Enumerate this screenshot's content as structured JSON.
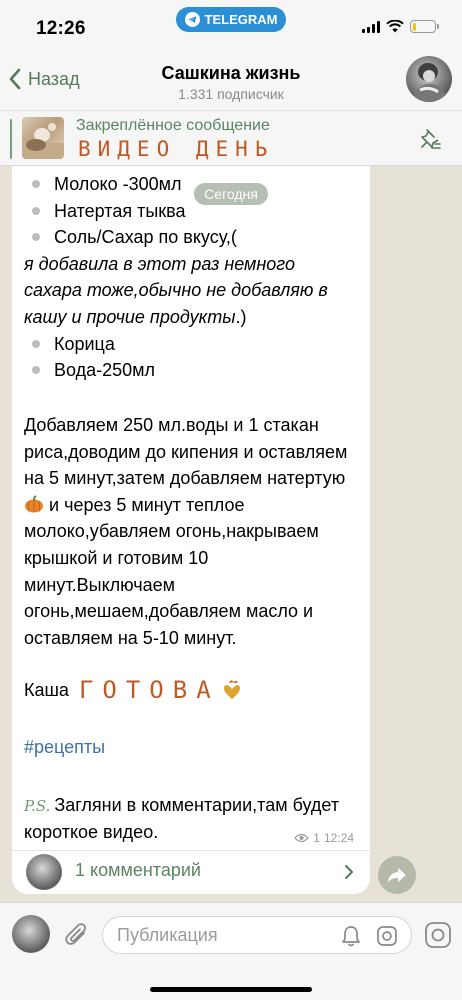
{
  "status": {
    "time": "12:26",
    "app_pill": "TELEGRAM",
    "battery_level": 0.18
  },
  "header": {
    "back_label": "Назад",
    "title": "Сашкина жизнь",
    "subtitle": "1.331 подписчик"
  },
  "pinned": {
    "label": "Закреплённое сообщение",
    "text": "ВИДЕО ДЕНЬ"
  },
  "date_chip": "Сегодня",
  "message": {
    "list_top": [
      "Молоко -300мл",
      "Натертая тыква"
    ],
    "salt_item": "Соль/Сахар по вкусу,(",
    "salt_italic": "я добавила в этот раз немного сахара тоже,обычно не добавляю в кашу и прочие продукты",
    "salt_tail": ".)",
    "list_bottom": [
      "Корица",
      "Вода-250мл"
    ],
    "para_part1": "Добавляем 250 мл.воды и 1 стакан риса,доводим до кипения и оставляем на 5 минут,затем добавляем натертую",
    "para_part2": "и через 5 минут теплое молоко,убавляем огонь,накрываем крышкой и готовим 10 минут.Выключаем огонь,мешаем,добавляем масло и оставляем на 5-10 минут.",
    "kasha_label": "Каша",
    "kasha_word": "ГОТОВА",
    "hashtag": "#рецепты",
    "ps_badge": "P.S.",
    "ps_text": "Загляни в комментарии,там будет короткое видео.",
    "views": "1",
    "time": "12:24"
  },
  "comments": {
    "label": "1 комментарий"
  },
  "input": {
    "placeholder": "Публикация"
  },
  "colors": {
    "accent": "#557a5a",
    "link": "#3c72a8",
    "handwriting": "#c05a25",
    "telegram_pill": "#2b8fd6"
  },
  "icons": [
    "telegram-icon",
    "signal-icon",
    "wifi-icon",
    "battery-icon",
    "back-chevron-icon",
    "pin-list-icon",
    "pumpkin-icon",
    "heart-icon",
    "eye-icon",
    "chevron-right-icon",
    "share-icon",
    "paperclip-icon",
    "bell-icon",
    "sticker-icon",
    "camera-icon"
  ]
}
